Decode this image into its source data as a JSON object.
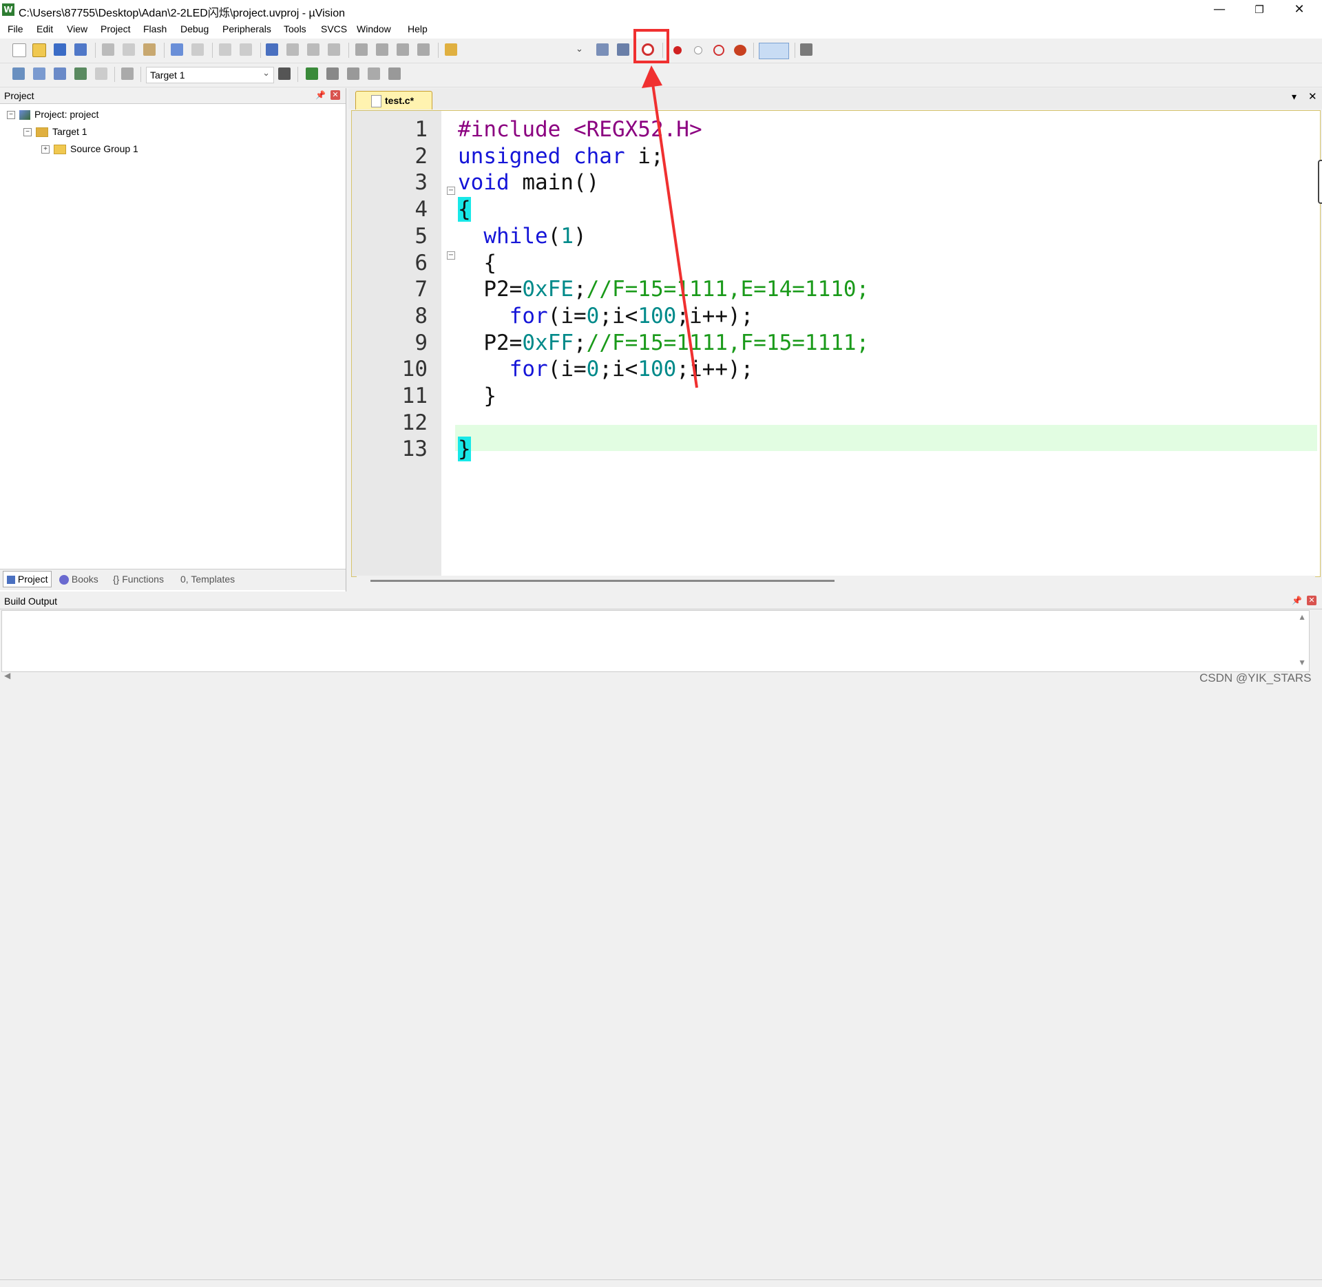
{
  "window": {
    "title": "C:\\Users\\87755\\Desktop\\Adan\\2-2LED闪烁\\project.uvproj - µVision",
    "app_icon": "W",
    "controls": {
      "minimize": "—",
      "restore": "❐",
      "close": "✕"
    }
  },
  "menu": [
    "File",
    "Edit",
    "View",
    "Project",
    "Flash",
    "Debug",
    "Peripherals",
    "Tools",
    "SVCS",
    "Window",
    "Help"
  ],
  "toolbar2": {
    "target_select": "Target 1"
  },
  "project_panel": {
    "title": "Project",
    "tree": {
      "root": "Project: project",
      "target": "Target 1",
      "group": "Source Group 1"
    },
    "tabs": [
      "Project",
      "Books",
      "Functions",
      "Templates"
    ]
  },
  "editor": {
    "tab": "test.c*",
    "lines": [
      {
        "n": "1",
        "indent": "",
        "parts": [
          [
            "pp",
            "#include <REGX52.H>"
          ]
        ]
      },
      {
        "n": "2",
        "indent": "",
        "parts": [
          [
            "kw",
            "unsigned char"
          ],
          [
            "plain",
            " i;"
          ]
        ]
      },
      {
        "n": "3",
        "indent": "",
        "parts": [
          [
            "kw",
            "void"
          ],
          [
            "plain",
            " main()"
          ]
        ]
      },
      {
        "n": "4",
        "indent": "",
        "parts": [
          [
            "brace",
            "{"
          ]
        ]
      },
      {
        "n": "5",
        "indent": "  ",
        "parts": [
          [
            "kw",
            "while"
          ],
          [
            "plain",
            "("
          ],
          [
            "num",
            "1"
          ],
          [
            "plain",
            ")"
          ]
        ]
      },
      {
        "n": "6",
        "indent": "  ",
        "parts": [
          [
            "plain",
            "{"
          ]
        ]
      },
      {
        "n": "7",
        "indent": "  ",
        "parts": [
          [
            "plain",
            "P2="
          ],
          [
            "num",
            "0xFE"
          ],
          [
            "plain",
            ";"
          ],
          [
            "cm",
            "//F=15=1111,E=14=1110;"
          ]
        ]
      },
      {
        "n": "8",
        "indent": "    ",
        "parts": [
          [
            "kw",
            "for"
          ],
          [
            "plain",
            "(i="
          ],
          [
            "num",
            "0"
          ],
          [
            "plain",
            ";i<"
          ],
          [
            "num",
            "100"
          ],
          [
            "plain",
            ";i++);"
          ]
        ]
      },
      {
        "n": "9",
        "indent": "  ",
        "parts": [
          [
            "plain",
            "P2="
          ],
          [
            "num",
            "0xFF"
          ],
          [
            "plain",
            ";"
          ],
          [
            "cm",
            "//F=15=1111,F=15=1111;"
          ]
        ]
      },
      {
        "n": "10",
        "indent": "    ",
        "parts": [
          [
            "kw",
            "for"
          ],
          [
            "plain",
            "(i="
          ],
          [
            "num",
            "0"
          ],
          [
            "plain",
            ";i<"
          ],
          [
            "num",
            "100"
          ],
          [
            "plain",
            ";i++);"
          ]
        ]
      },
      {
        "n": "11",
        "indent": "  ",
        "parts": [
          [
            "plain",
            "}"
          ]
        ]
      },
      {
        "n": "12",
        "indent": "",
        "parts": []
      },
      {
        "n": "13",
        "indent": "",
        "parts": [
          [
            "brace",
            "}"
          ]
        ]
      }
    ]
  },
  "build_output": {
    "title": "Build Output"
  },
  "watermark": "CSDN @YIK_STARS",
  "colors": {
    "keyword": "#1515d8",
    "preprocessor": "#8b0080",
    "number": "#008a8a",
    "comment": "#1a9a1a",
    "annotation": "#f03030"
  }
}
